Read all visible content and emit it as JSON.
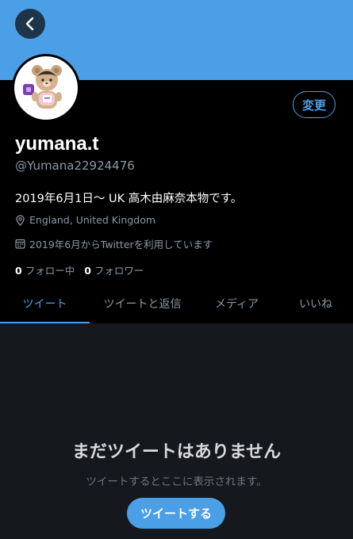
{
  "header": {
    "back_icon": "chevron-left-icon"
  },
  "profile": {
    "avatar_icon": "bear-avatar-icon",
    "edit_label": "変更",
    "display_name": "yumana.t",
    "handle": "@Yumana22924476",
    "bio": "2019年6月1日〜 UK 高木由麻奈本物です。",
    "location": "England, United Kingdom",
    "joined": "2019年6月からTwitterを利用しています",
    "following_count": "0",
    "following_label": "フォロー中",
    "followers_count": "0",
    "followers_label": "フォロワー"
  },
  "tabs": [
    {
      "label": "ツイート",
      "active": true
    },
    {
      "label": "ツイートと返信",
      "active": false
    },
    {
      "label": "メディア",
      "active": false
    },
    {
      "label": "いいね",
      "active": false
    }
  ],
  "empty_state": {
    "title": "まだツイートはありません",
    "subtitle": "ツイートするとここに表示されます。",
    "button_label": "ツイートする"
  },
  "colors": {
    "accent": "#4a9fe6",
    "background": "#000000",
    "secondary_text": "#8b98a5"
  }
}
